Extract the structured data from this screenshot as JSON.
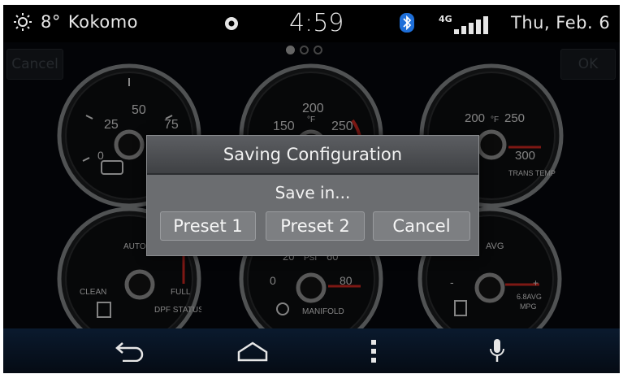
{
  "status_bar": {
    "temperature": "8°",
    "city": "Kokomo",
    "time": "4:59",
    "network": "4G",
    "date": "Thu, Feb. 6"
  },
  "top_buttons": {
    "cancel_label": "Cancel",
    "ok_label": "OK"
  },
  "pager": {
    "pages": 3,
    "active": 1
  },
  "gauges": {
    "boost": {
      "ticks": [
        "0",
        "25",
        "50",
        "75"
      ]
    },
    "coolant": {
      "ticks": [
        "150",
        "200",
        "250"
      ],
      "unit": "°F"
    },
    "trans_temp": {
      "ticks": [
        "200",
        "250",
        "300"
      ],
      "unit": "°F",
      "name": "TRANS TEMP"
    },
    "dpf": {
      "top": "AUTO REGEN",
      "left": "CLEAN",
      "right": "FULL",
      "name": "DPF STATUS"
    },
    "manifold": {
      "ticks": [
        "0",
        "20",
        "PSI",
        "60",
        "80"
      ],
      "name": "MANIFOLD"
    },
    "mpg": {
      "top": "AVG",
      "minus": "-",
      "plus": "+",
      "value": "6.8AVG",
      "name": "MPG"
    }
  },
  "dialog": {
    "title": "Saving Configuration",
    "message": "Save in...",
    "buttons": {
      "preset1": "Preset 1",
      "preset2": "Preset 2",
      "cancel": "Cancel"
    }
  },
  "nav": {
    "icons": [
      "back-icon",
      "home-icon",
      "menu-icon",
      "microphone-icon"
    ]
  }
}
